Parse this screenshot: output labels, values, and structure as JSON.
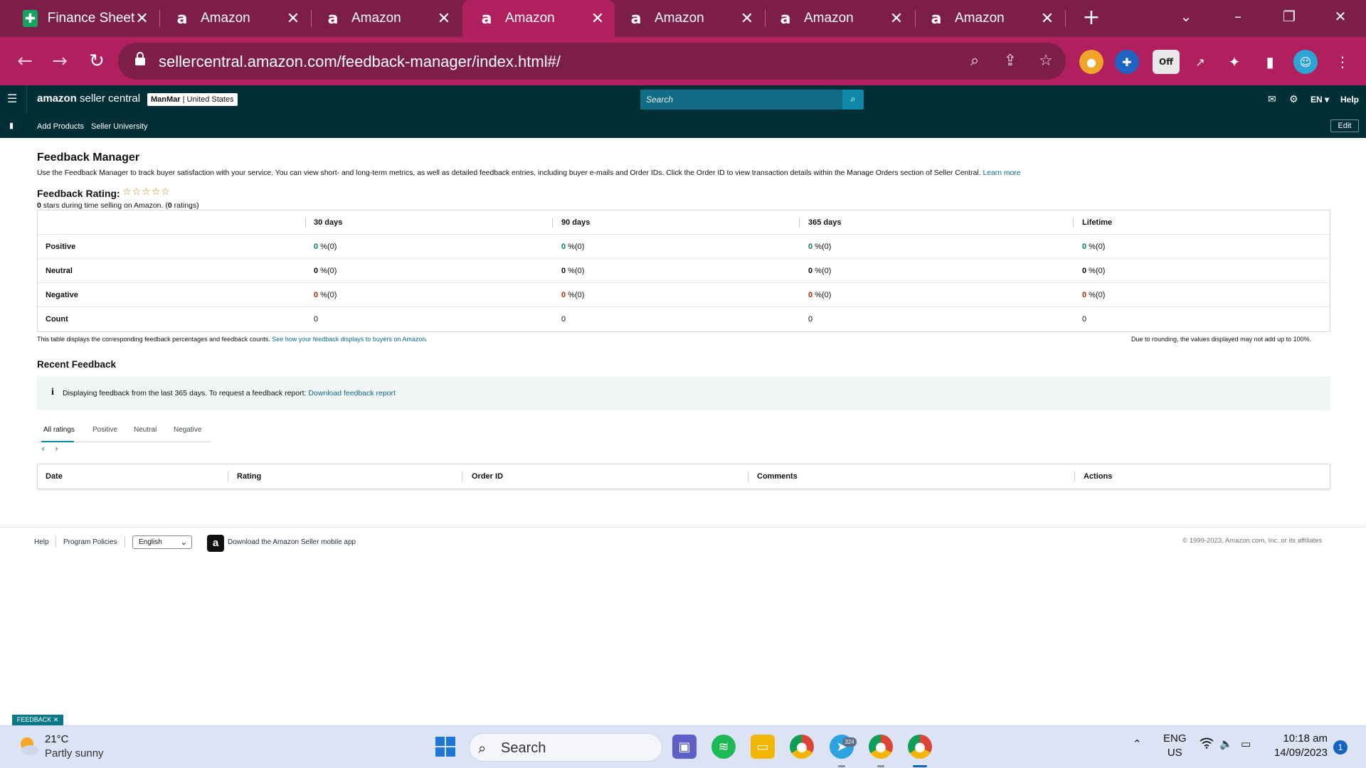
{
  "browser": {
    "tabs": [
      {
        "title": "Finance Sheet",
        "favicon": "google-sheets-icon"
      },
      {
        "title": "Amazon",
        "favicon": "amazon-icon"
      },
      {
        "title": "Amazon",
        "favicon": "amazon-icon"
      },
      {
        "title": "Amazon",
        "favicon": "amazon-icon",
        "active": true
      },
      {
        "title": "Amazon",
        "favicon": "amazon-icon"
      },
      {
        "title": "Amazon",
        "favicon": "amazon-icon"
      },
      {
        "title": "Amazon",
        "favicon": "amazon-icon"
      }
    ],
    "url": "sellercentral.amazon.com/feedback-manager/index.html#/",
    "extension_badge": "Off",
    "theme_colors": {
      "tabbar": "#7d1d4a",
      "toolbar": "#b0205f"
    }
  },
  "seller_header": {
    "logo_brand": "amazon",
    "logo_product": " seller central",
    "account_name": "ManMar",
    "account_region": "United States",
    "search_placeholder": "Search",
    "language": "EN",
    "help": "Help",
    "nav_links": [
      "Add Products",
      "Seller University"
    ],
    "edit_label": "Edit"
  },
  "feedback_manager": {
    "title": "Feedback Manager",
    "description": "Use the Feedback Manager to track buyer satisfaction with your service. You can view short- and long-term metrics, as well as detailed feedback entries, including buyer e-mails and Order IDs. Click the Order ID to view transaction details within the Manage Orders section of Seller Central.",
    "learn_more": "Learn more",
    "rating_label": "Feedback Rating:",
    "stars": "☆☆☆☆☆",
    "rating_count_stars": "0",
    "rating_summary_mid": " stars during time selling on Amazon. (",
    "rating_count": "0",
    "rating_summary_end": " ratings)"
  },
  "metrics_table": {
    "columns": [
      "30 days",
      "90 days",
      "365 days",
      "Lifetime"
    ],
    "rows": [
      {
        "label": "Positive",
        "values": [
          "0",
          "0",
          "0",
          "0"
        ],
        "suffix": " %(0)"
      },
      {
        "label": "Neutral",
        "values": [
          "0",
          "0",
          "0",
          "0"
        ],
        "suffix": " %(0)"
      },
      {
        "label": "Negative",
        "values": [
          "0",
          "0",
          "0",
          "0"
        ],
        "suffix": " %(0)"
      },
      {
        "label": "Count",
        "values": [
          "0",
          "0",
          "0",
          "0"
        ],
        "suffix": ""
      }
    ],
    "note_left": "This table displays the corresponding feedback percentages and feedback counts.",
    "note_link": "See how your feedback displays to buyers on Amazon.",
    "note_right": "Due to rounding, the values displayed may not add up to 100%."
  },
  "recent_feedback": {
    "title": "Recent Feedback",
    "info_text": "Displaying feedback from the last 365 days. To request a feedback report:",
    "info_link": "Download feedback report",
    "filter_tabs": [
      "All ratings",
      "Positive",
      "Neutral",
      "Negative"
    ],
    "active_filter": "All ratings",
    "list_columns": [
      "Date",
      "Rating",
      "Order ID",
      "Comments",
      "Actions"
    ]
  },
  "footer": {
    "links": [
      "Help",
      "Program Policies"
    ],
    "language_value": "English",
    "app_text": "Download the Amazon Seller mobile app",
    "copyright": "© 1999-2023, Amazon.com, Inc. or its affiliates",
    "feedback_tag": "FEEDBACK ✕"
  },
  "taskbar": {
    "temperature": "21°C",
    "weather": "Partly sunny",
    "search_label": "Search",
    "telegram_badge": "324",
    "lang_primary": "ENG",
    "lang_secondary": "US",
    "time": "10:18 am",
    "date": "14/09/2023",
    "notifications": "1"
  }
}
